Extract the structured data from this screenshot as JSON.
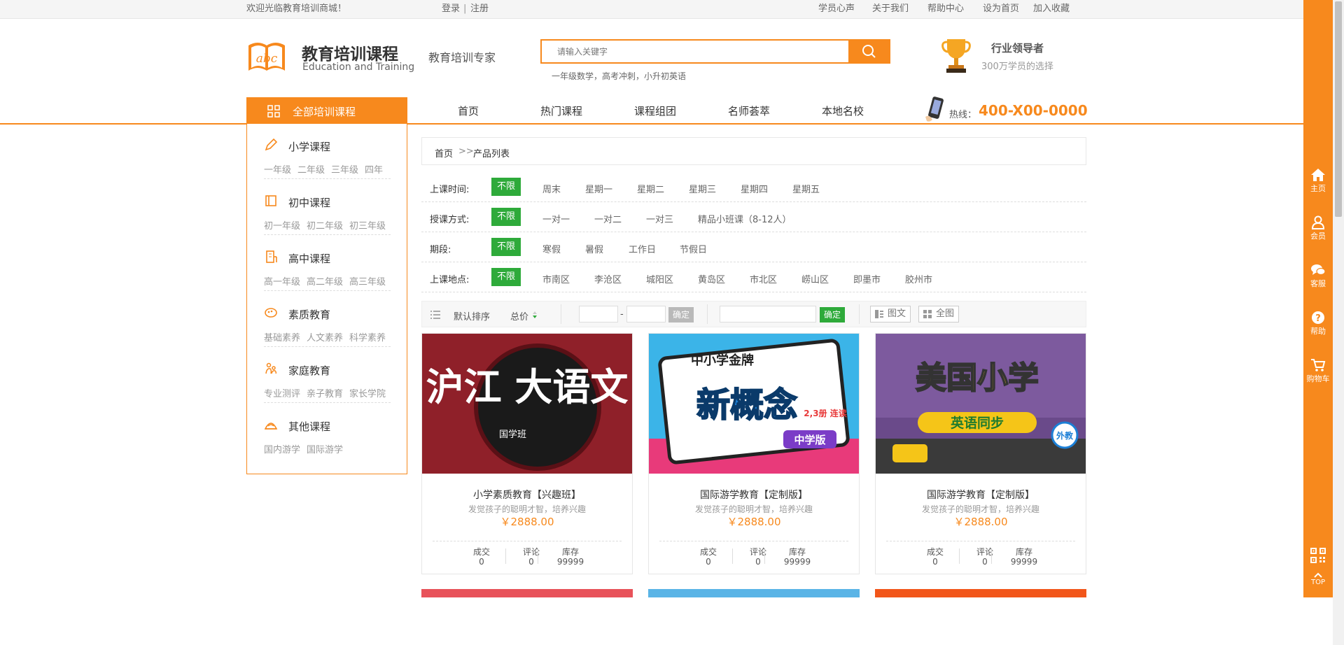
{
  "topbar": {
    "welcome": "欢迎光临教育培训商城！",
    "login": "登录",
    "divider": "|",
    "register": "注册",
    "links": [
      "学员心声",
      "关于我们",
      "帮助中心",
      "设为首页",
      "加入收藏"
    ]
  },
  "header": {
    "logo_badge": "abc",
    "logo_cn": "教育培训课程",
    "logo_en": "Education and Training",
    "slogan": "教育培训专家",
    "search_placeholder": "请输入关键字",
    "hot_words": "一年级数学，高考冲刺，小升初英语",
    "leader_title": "行业领导者",
    "leader_sub": "300万学员的选择"
  },
  "nav": {
    "all_courses": "全部培训课程",
    "items": [
      "首页",
      "热门课程",
      "课程组团",
      "名师荟萃",
      "本地名校"
    ],
    "hotline_label": "热线：",
    "hotline_number": "400-X00-0000"
  },
  "categories": [
    {
      "title": "小学课程",
      "icon": "pencil-icon",
      "subs": [
        "一年级",
        "二年级",
        "三年级",
        "四年"
      ]
    },
    {
      "title": "初中课程",
      "icon": "book-icon",
      "subs": [
        "初一年级",
        "初二年级",
        "初三年级"
      ]
    },
    {
      "title": "高中课程",
      "icon": "building-icon",
      "subs": [
        "高一年级",
        "高二年级",
        "高三年级"
      ]
    },
    {
      "title": "素质教育",
      "icon": "palette-icon",
      "subs": [
        "基础素养",
        "人文素养",
        "科学素养"
      ]
    },
    {
      "title": "家庭教育",
      "icon": "family-icon",
      "subs": [
        "专业测评",
        "亲子教育",
        "家长学院"
      ]
    },
    {
      "title": "其他课程",
      "icon": "globe-icon",
      "subs": [
        "国内游学",
        "国际游学"
      ]
    }
  ],
  "breadcrumb": {
    "home": "首页",
    "sep": ">>",
    "current": "产品列表"
  },
  "filters": [
    {
      "label": "上课时间:",
      "options": [
        "不限",
        "周末",
        "星期一",
        "星期二",
        "星期三",
        "星期四",
        "星期五"
      ]
    },
    {
      "label": "授课方式:",
      "options": [
        "不限",
        "一对一",
        "一对二",
        "一对三",
        "精品小班课（8-12人）"
      ]
    },
    {
      "label": "期段:",
      "options": [
        "不限",
        "寒假",
        "暑假",
        "工作日",
        "节假日"
      ]
    },
    {
      "label": "上课地点:",
      "options": [
        "不限",
        "市南区",
        "李沧区",
        "城阳区",
        "黄岛区",
        "市北区",
        "崂山区",
        "即墨市",
        "胶州市"
      ]
    }
  ],
  "sortbar": {
    "default_sort": "默认排序",
    "price_sort": "总价",
    "range_dash": "-",
    "confirm1": "确定",
    "confirm2": "确定",
    "view_list": "图文",
    "view_grid": "全图"
  },
  "products": [
    {
      "image_text": "沪江 大语文",
      "image_sub": "国学班",
      "name": "小学素质教育【兴趣班】",
      "desc": "发觉孩子的聪明才智，培养兴趣",
      "price": "￥2888.00",
      "stats": [
        {
          "label": "成交",
          "value": "0"
        },
        {
          "label": "评论",
          "value": "0"
        },
        {
          "label": "库存",
          "value": "99999"
        }
      ]
    },
    {
      "image_text": "新概念",
      "image_top": "中小学金牌",
      "image_badge": "中学版",
      "image_sub": "2,3册 连读",
      "name": "国际游学教育【定制版】",
      "desc": "发觉孩子的聪明才智，培养兴趣",
      "price": "￥2888.00",
      "stats": [
        {
          "label": "成交",
          "value": "0"
        },
        {
          "label": "评论",
          "value": "0"
        },
        {
          "label": "库存",
          "value": "99999"
        }
      ]
    },
    {
      "image_text": "美国小学",
      "image_sub": "英语同步",
      "image_badge": "外教",
      "name": "国际游学教育【定制版】",
      "desc": "发觉孩子的聪明才智，培养兴趣",
      "price": "￥2888.00",
      "stats": [
        {
          "label": "成交",
          "value": "0"
        },
        {
          "label": "评论",
          "value": "0"
        },
        {
          "label": "库存",
          "value": "99999"
        }
      ]
    }
  ],
  "rightbar": [
    {
      "label": "主页",
      "icon": "home-icon"
    },
    {
      "label": "会员",
      "icon": "user-icon"
    },
    {
      "label": "客服",
      "icon": "chat-icon"
    },
    {
      "label": "帮助",
      "icon": "help-icon"
    },
    {
      "label": "购物车",
      "icon": "cart-icon"
    }
  ],
  "rightbar_top": "TOP",
  "colors": {
    "accent": "#f7891d",
    "green": "#2eaa3a",
    "confirm_gray": "#b9b9b9"
  }
}
